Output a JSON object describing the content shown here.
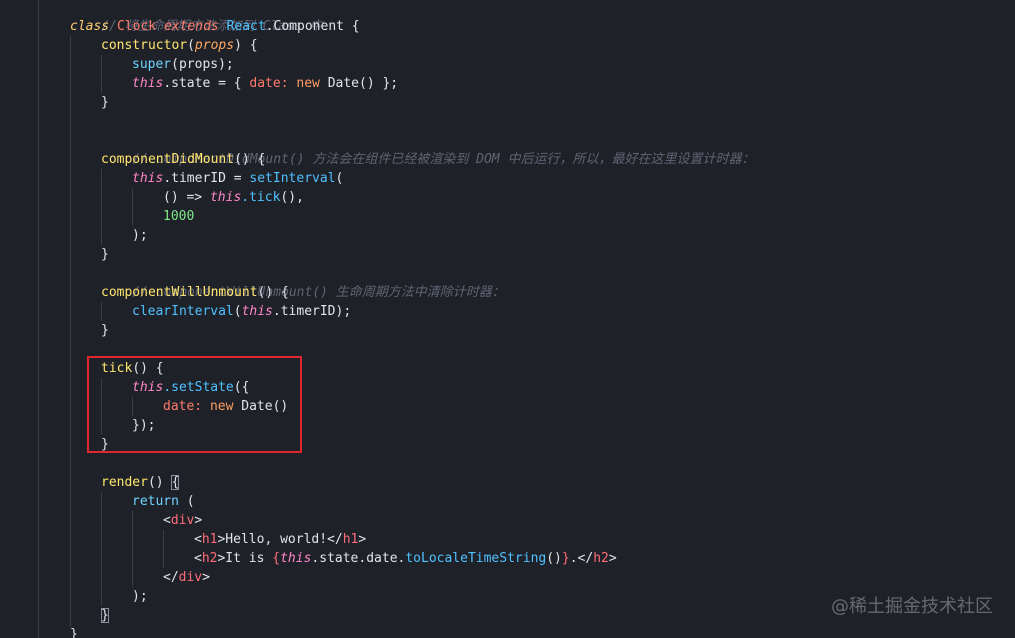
{
  "editor": {
    "language": "javascript",
    "lines": {
      "l1_comment": "// 将生命周期方法添加到 Class 中",
      "l2_class": "class",
      "l2_name": "Clock",
      "l2_extends": "extends",
      "l2_react": "React",
      "l2_component": ".Component {",
      "l3_ctor": "constructor",
      "l3_open": "(",
      "l3_props": "props",
      "l3_close": ") {",
      "l4_super": "super",
      "l4_rest": "(props);",
      "l5_this": "this",
      "l5_state": ".state = { ",
      "l5_date": "date:",
      "l5_new": " new ",
      "l5_end": "Date() };",
      "l6_brace": "}",
      "l8_comment": "// componentDidMount() 方法会在组件已经被渲染到 DOM 中后运行，所以，最好在这里设置计时器：",
      "l9_fn": "componentDidMount",
      "l9_rest": "() {",
      "l10_this": "this",
      "l10_timer": ".timerID = ",
      "l10_set": "setInterval",
      "l10_paren": "(",
      "l11_arrow": "() => ",
      "l11_this": "this",
      "l11_tick": ".tick",
      "l11_end": "(),",
      "l12_num": "1000",
      "l13_close": ");",
      "l14_brace": "}",
      "l15_comment": "// componentWillUnmount() 生命周期方法中清除计时器：",
      "l16_fn": "componentWillUnmount",
      "l16_rest": "() {",
      "l17_clear": "clearInterval",
      "l17_open": "(",
      "l17_this": "this",
      "l17_end": ".timerID);",
      "l18_brace": "}",
      "l20_tick": "tick",
      "l20_rest": "() {",
      "l21_this": "this",
      "l21_set": ".setState",
      "l21_rest": "({",
      "l22_date": "date:",
      "l22_new": " new ",
      "l22_end": "Date()",
      "l23_close": "});",
      "l24_brace": "}",
      "l26_render": "render",
      "l26_paren": "() ",
      "l26_brace": "{",
      "l27_return": "return",
      "l27_paren": " (",
      "l28_lt": "<",
      "l28_tag": "div",
      "l28_gt": ">",
      "l29_lt": "<",
      "l29_tag": "h1",
      "l29_text": ">Hello, world!</",
      "l29_tag2": "h1",
      "l29_gt": ">",
      "l30_lt": "<",
      "l30_tag": "h2",
      "l30_text": ">It is ",
      "l30_ob": "{",
      "l30_this": "this",
      "l30_state": ".state.date.",
      "l30_method": "toLocaleTimeString",
      "l30_call": "()",
      "l30_cb": "}",
      "l30_dot": ".</",
      "l30_tag2": "h2",
      "l30_gt": ">",
      "l31_lt": "</",
      "l31_tag": "div",
      "l31_gt": ">",
      "l32_close": ");",
      "l33_brace": "}",
      "l34_brace": "}"
    }
  },
  "watermark": {
    "text": "@稀土掘金技术社区"
  },
  "colors": {
    "background": "#1f2129",
    "highlight_border": "#e0262f"
  }
}
